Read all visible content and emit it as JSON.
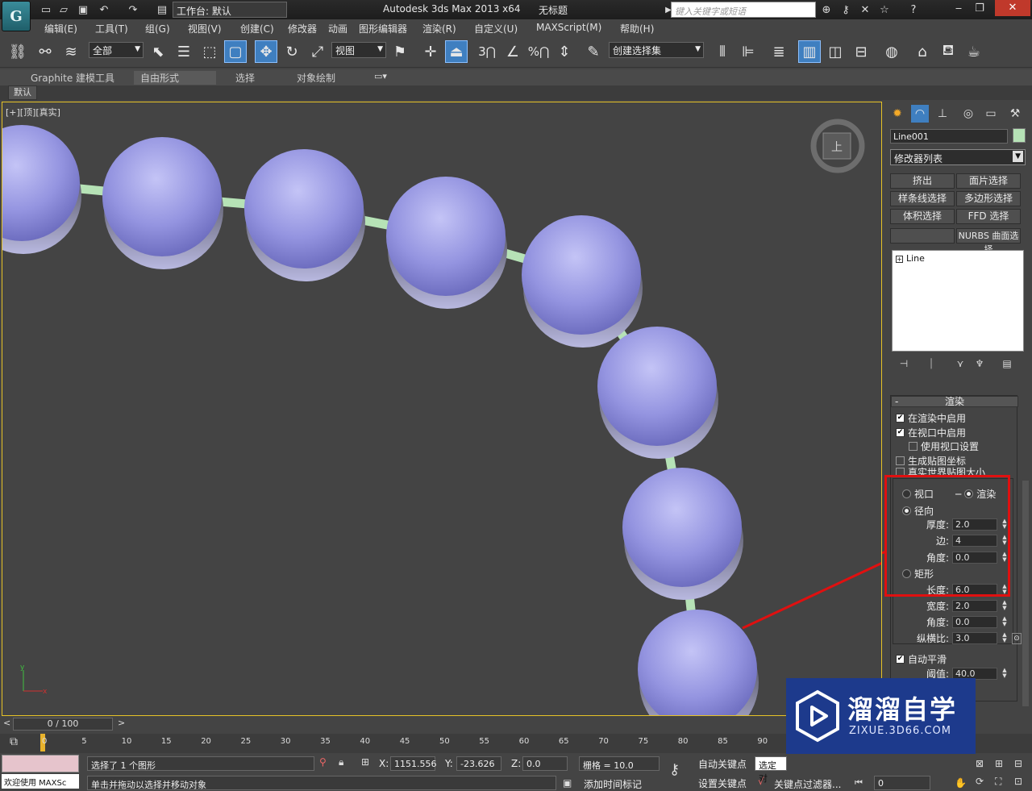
{
  "titlebar": {
    "workspace_label": "工作台: 默认",
    "app_title": "Autodesk 3ds Max  2013 x64",
    "file_title": "无标题",
    "search_placeholder": "键入关键字或短语",
    "app_logo": "G"
  },
  "menu": [
    "编辑(E)",
    "工具(T)",
    "组(G)",
    "视图(V)",
    "创建(C)",
    "修改器",
    "动画",
    "图形编辑器",
    "渲染(R)",
    "自定义(U)",
    "MAXScript(M)",
    "帮助(H)"
  ],
  "toolbar": {
    "selection_filter": "全部",
    "ref_coord": "视图",
    "named_selection": "创建选择集",
    "snap_label": "3",
    "percent_label": "%"
  },
  "ribbon": {
    "tabs": [
      "Graphite 建模工具",
      "自由形式",
      "选择",
      "对象绘制"
    ],
    "sub_label": "默认"
  },
  "viewport": {
    "label": "[+][顶][真实]",
    "viewcube_label": "上"
  },
  "command_panel": {
    "object_name": "Line001",
    "object_color": "#b6e2b6",
    "modifier_list": "修改器列表",
    "buttons": [
      "挤出",
      "面片选择",
      "样条线选择",
      "多边形选择",
      "体积选择",
      "FFD 选择",
      "",
      "NURBS 曲面选择"
    ],
    "stack_item": "Line",
    "rollout_title": "渲染",
    "enable_in_renderer": "在渲染中启用",
    "enable_in_viewport": "在视口中启用",
    "use_viewport_settings": "使用视口设置",
    "gen_mapping": "生成贴图坐标",
    "real_world": "真实世界贴图大小",
    "viewport_radio": "视口",
    "render_radio": "渲染",
    "radial": "径向",
    "thickness_label": "厚度:",
    "thickness": "2.0",
    "sides_label": "边:",
    "sides": "4",
    "angle_label": "角度:",
    "angle": "0.0",
    "rectangular": "矩形",
    "length_label": "长度:",
    "length": "6.0",
    "width_label": "宽度:",
    "width": "2.0",
    "angle2_label": "角度:",
    "angle2": "0.0",
    "aspect_label": "纵横比:",
    "aspect": "3.0",
    "auto_smooth": "自动平滑",
    "threshold_label": "阈值:",
    "threshold": "40.0"
  },
  "timeline": {
    "frame": "0 / 100",
    "ticks": [
      "0",
      "5",
      "10",
      "15",
      "20",
      "25",
      "30",
      "35",
      "40",
      "45",
      "50",
      "55",
      "60",
      "65",
      "70",
      "75",
      "80",
      "85",
      "90"
    ]
  },
  "status": {
    "welcome": "欢迎使用 MAXSc",
    "selected": "选择了 1 个图形",
    "prompt": "单击并拖动以选择并移动对象",
    "x_label": "X:",
    "x": "1151.556",
    "y_label": "Y:",
    "y": "-23.626",
    "z_label": "Z:",
    "z": "0.0",
    "grid": "栅格 = 10.0",
    "auto_key": "自动关键点",
    "set_key": "设置关键点",
    "selected_obj": "选定对",
    "add_time_tag": "添加时间标记",
    "key_filters": "关键点过滤器...",
    "frame_field": "0"
  },
  "watermark": {
    "brand": "溜溜自学",
    "url": "ZIXUE.3D66.COM"
  },
  "colors": {
    "viewport_border": "#e6c227",
    "bead": "#9a9ae6",
    "string": "#b6e2b6",
    "highlight": "#e01010",
    "watermark_bg": "#1d3a8c"
  }
}
